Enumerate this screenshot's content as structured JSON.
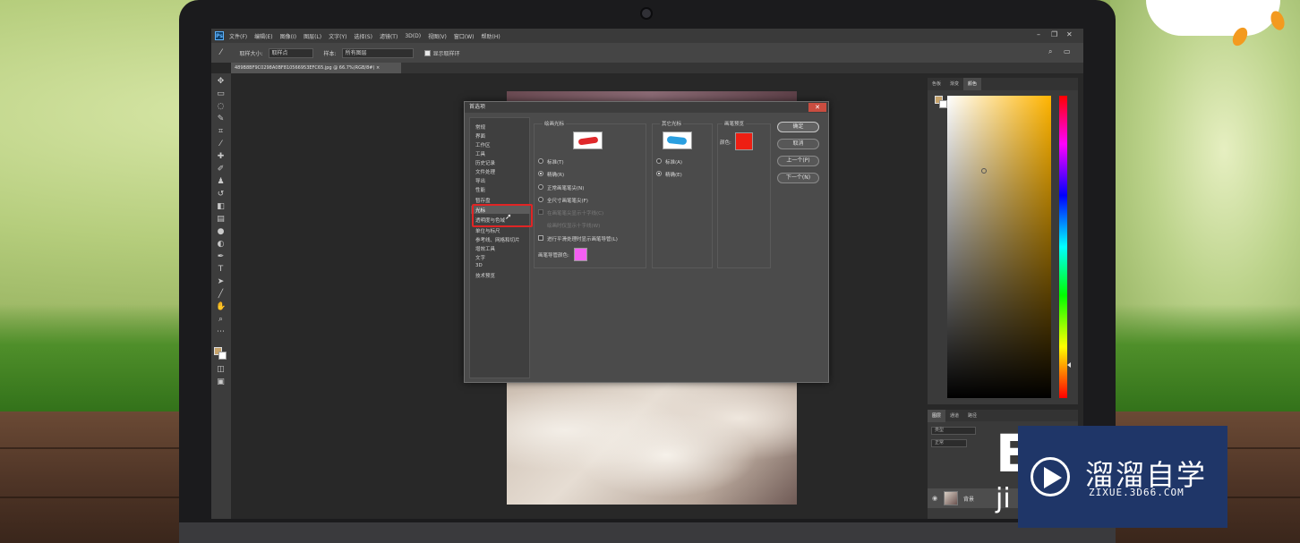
{
  "photoshop": {
    "app_icon": "Ps",
    "menu": [
      "文件(F)",
      "编辑(E)",
      "图像(I)",
      "图层(L)",
      "文字(Y)",
      "选择(S)",
      "滤镜(T)",
      "3D(D)",
      "视图(V)",
      "窗口(W)",
      "帮助(H)"
    ],
    "options": {
      "brush_size_label": "取样大小:",
      "brush_size_value": "取样点",
      "sample_label": "样本:",
      "sample_value": "所有图层",
      "show_ring_label": "显示取样环"
    },
    "doc_tab": "489B8BF9C0298A0BF810566953EFC65.jpg @ 66.7%(RGB/8#)",
    "color_panel_tabs": [
      "色板",
      "渐变",
      "颜色"
    ],
    "layers_panel_tabs": [
      "图层",
      "通道",
      "路径"
    ],
    "layers": {
      "kind_placeholder": "类型",
      "blend_mode": "正常",
      "layer_name": "背景"
    }
  },
  "dialog": {
    "title": "首选项",
    "nav_items": [
      "常规",
      "界面",
      "工作区",
      "工具",
      "历史记录",
      "文件处理",
      "导出",
      "性能",
      "暂存盘",
      "光标",
      "透明度与色域",
      "单位与标尺",
      "参考线、网格和切片",
      "增效工具",
      "文字",
      "3D",
      "技术预览"
    ],
    "selected_nav": "光标",
    "painting_cursors": {
      "title": "绘画光标",
      "options": [
        {
          "label": "标准(T)",
          "selected": false
        },
        {
          "label": "精确(R)",
          "selected": true
        },
        {
          "label": "正常画笔笔尖(N)",
          "selected": false
        },
        {
          "label": "全尺寸画笔笔尖(F)",
          "selected": false
        }
      ],
      "checkboxes": [
        {
          "label": "在画笔笔尖显示十字线(C)",
          "disabled": true
        },
        {
          "label": "绘画时仅显示十字线(W)",
          "disabled": true
        },
        {
          "label": "进行平滑处理时显示画笔导管(L)",
          "disabled": false
        }
      ],
      "overlay_color_label": "画笔导管颜色:",
      "overlay_color": "#f45ff2"
    },
    "other_cursors": {
      "title": "其它光标",
      "options": [
        {
          "label": "标准(A)",
          "selected": false
        },
        {
          "label": "精确(E)",
          "selected": true
        }
      ]
    },
    "brush_preview": {
      "title": "画笔预览",
      "color_label": "颜色:",
      "color": "#ee1f13"
    },
    "buttons": {
      "ok": "确定",
      "cancel": "取消",
      "prev": "上一个(P)",
      "next": "下一个(N)"
    }
  },
  "watermark": {
    "brand_cn": "溜溜自学",
    "url": "ZIXUE.3D66.COM",
    "overlay_big": "E",
    "overlay_small": "ji"
  },
  "colors": {
    "foreground": "#c6a36b",
    "background": "#ffffff",
    "accent_highlight": "#e02525"
  }
}
